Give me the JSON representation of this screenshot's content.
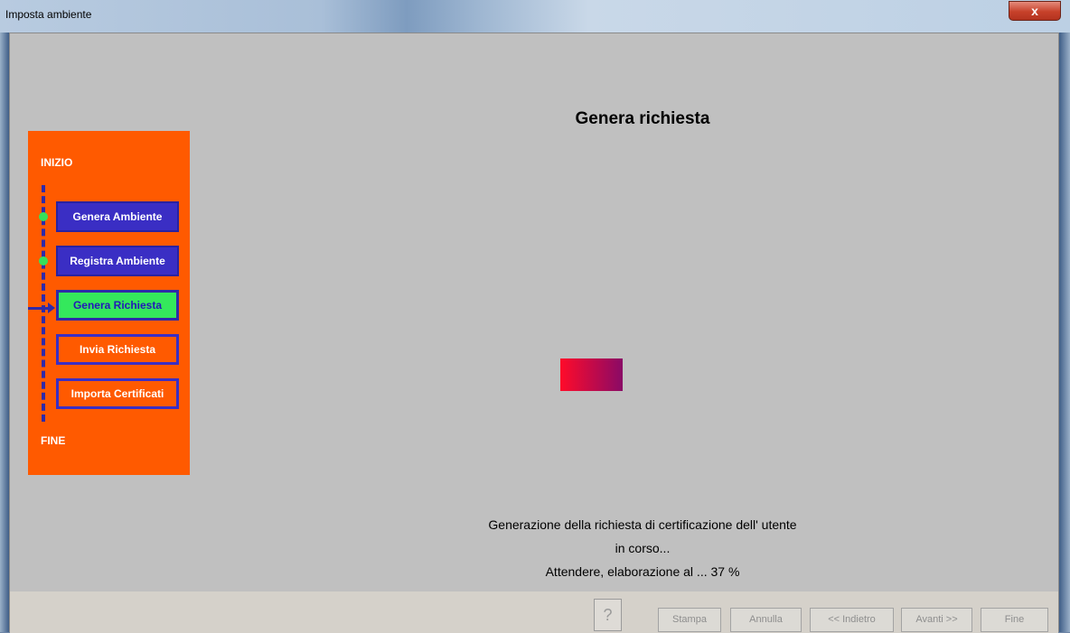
{
  "window": {
    "title": "Imposta ambiente",
    "close_label": "x"
  },
  "panel": {
    "start_label": "INIZIO",
    "end_label": "FINE",
    "steps": [
      {
        "label": "Genera Ambiente",
        "state": "done"
      },
      {
        "label": "Registra Ambiente",
        "state": "done"
      },
      {
        "label": "Genera Richiesta",
        "state": "current"
      },
      {
        "label": "Invia Richiesta",
        "state": "todo"
      },
      {
        "label": "Importa Certificati",
        "state": "todo"
      }
    ]
  },
  "main": {
    "title": "Genera richiesta",
    "message_line1": "Generazione della richiesta di certificazione dell' utente",
    "message_line2": "in corso...",
    "message_line3": "Attendere, elaborazione al ... 37 %",
    "progress_percent": 37
  },
  "footer": {
    "help_label": "?",
    "print_label": "Stampa",
    "cancel_label": "Annulla",
    "back_label": "<< Indietro",
    "next_label": "Avanti >>",
    "finish_label": "Fine"
  },
  "colors": {
    "panel_bg": "#ff5a00",
    "step_done": "#3a2ec4",
    "step_current": "#34e85c",
    "progress_start": "#ff0b2a",
    "progress_end": "#8a0a66"
  }
}
